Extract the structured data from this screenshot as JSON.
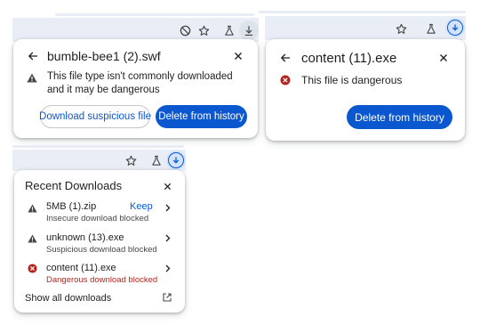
{
  "popup1": {
    "title": "bumble-bee1 (2).swf",
    "message": "This file type isn't commonly downloaded and it may be dangerous",
    "primary_button": "Delete from history",
    "secondary_button": "Download suspicious file"
  },
  "popup2": {
    "title": "content (11).exe",
    "message": "This file is dangerous",
    "primary_button": "Delete from history"
  },
  "popup3": {
    "title": "Recent Downloads",
    "items": [
      {
        "name": "5MB (1).zip",
        "status": "Insecure download blocked",
        "action": "Keep",
        "icon": "warning-icon"
      },
      {
        "name": "unknown (13).exe",
        "status": "Suspicious download blocked",
        "icon": "warning-icon"
      },
      {
        "name": "content (11).exe",
        "status": "Dangerous download blocked",
        "icon": "error-icon",
        "status_color": "#b3261e"
      }
    ],
    "footer": "Show all downloads"
  },
  "colors": {
    "accent": "#0b57d0",
    "danger": "#b3261e",
    "toolbar": "#e9eef6",
    "active_button": "#d3e3fd"
  }
}
